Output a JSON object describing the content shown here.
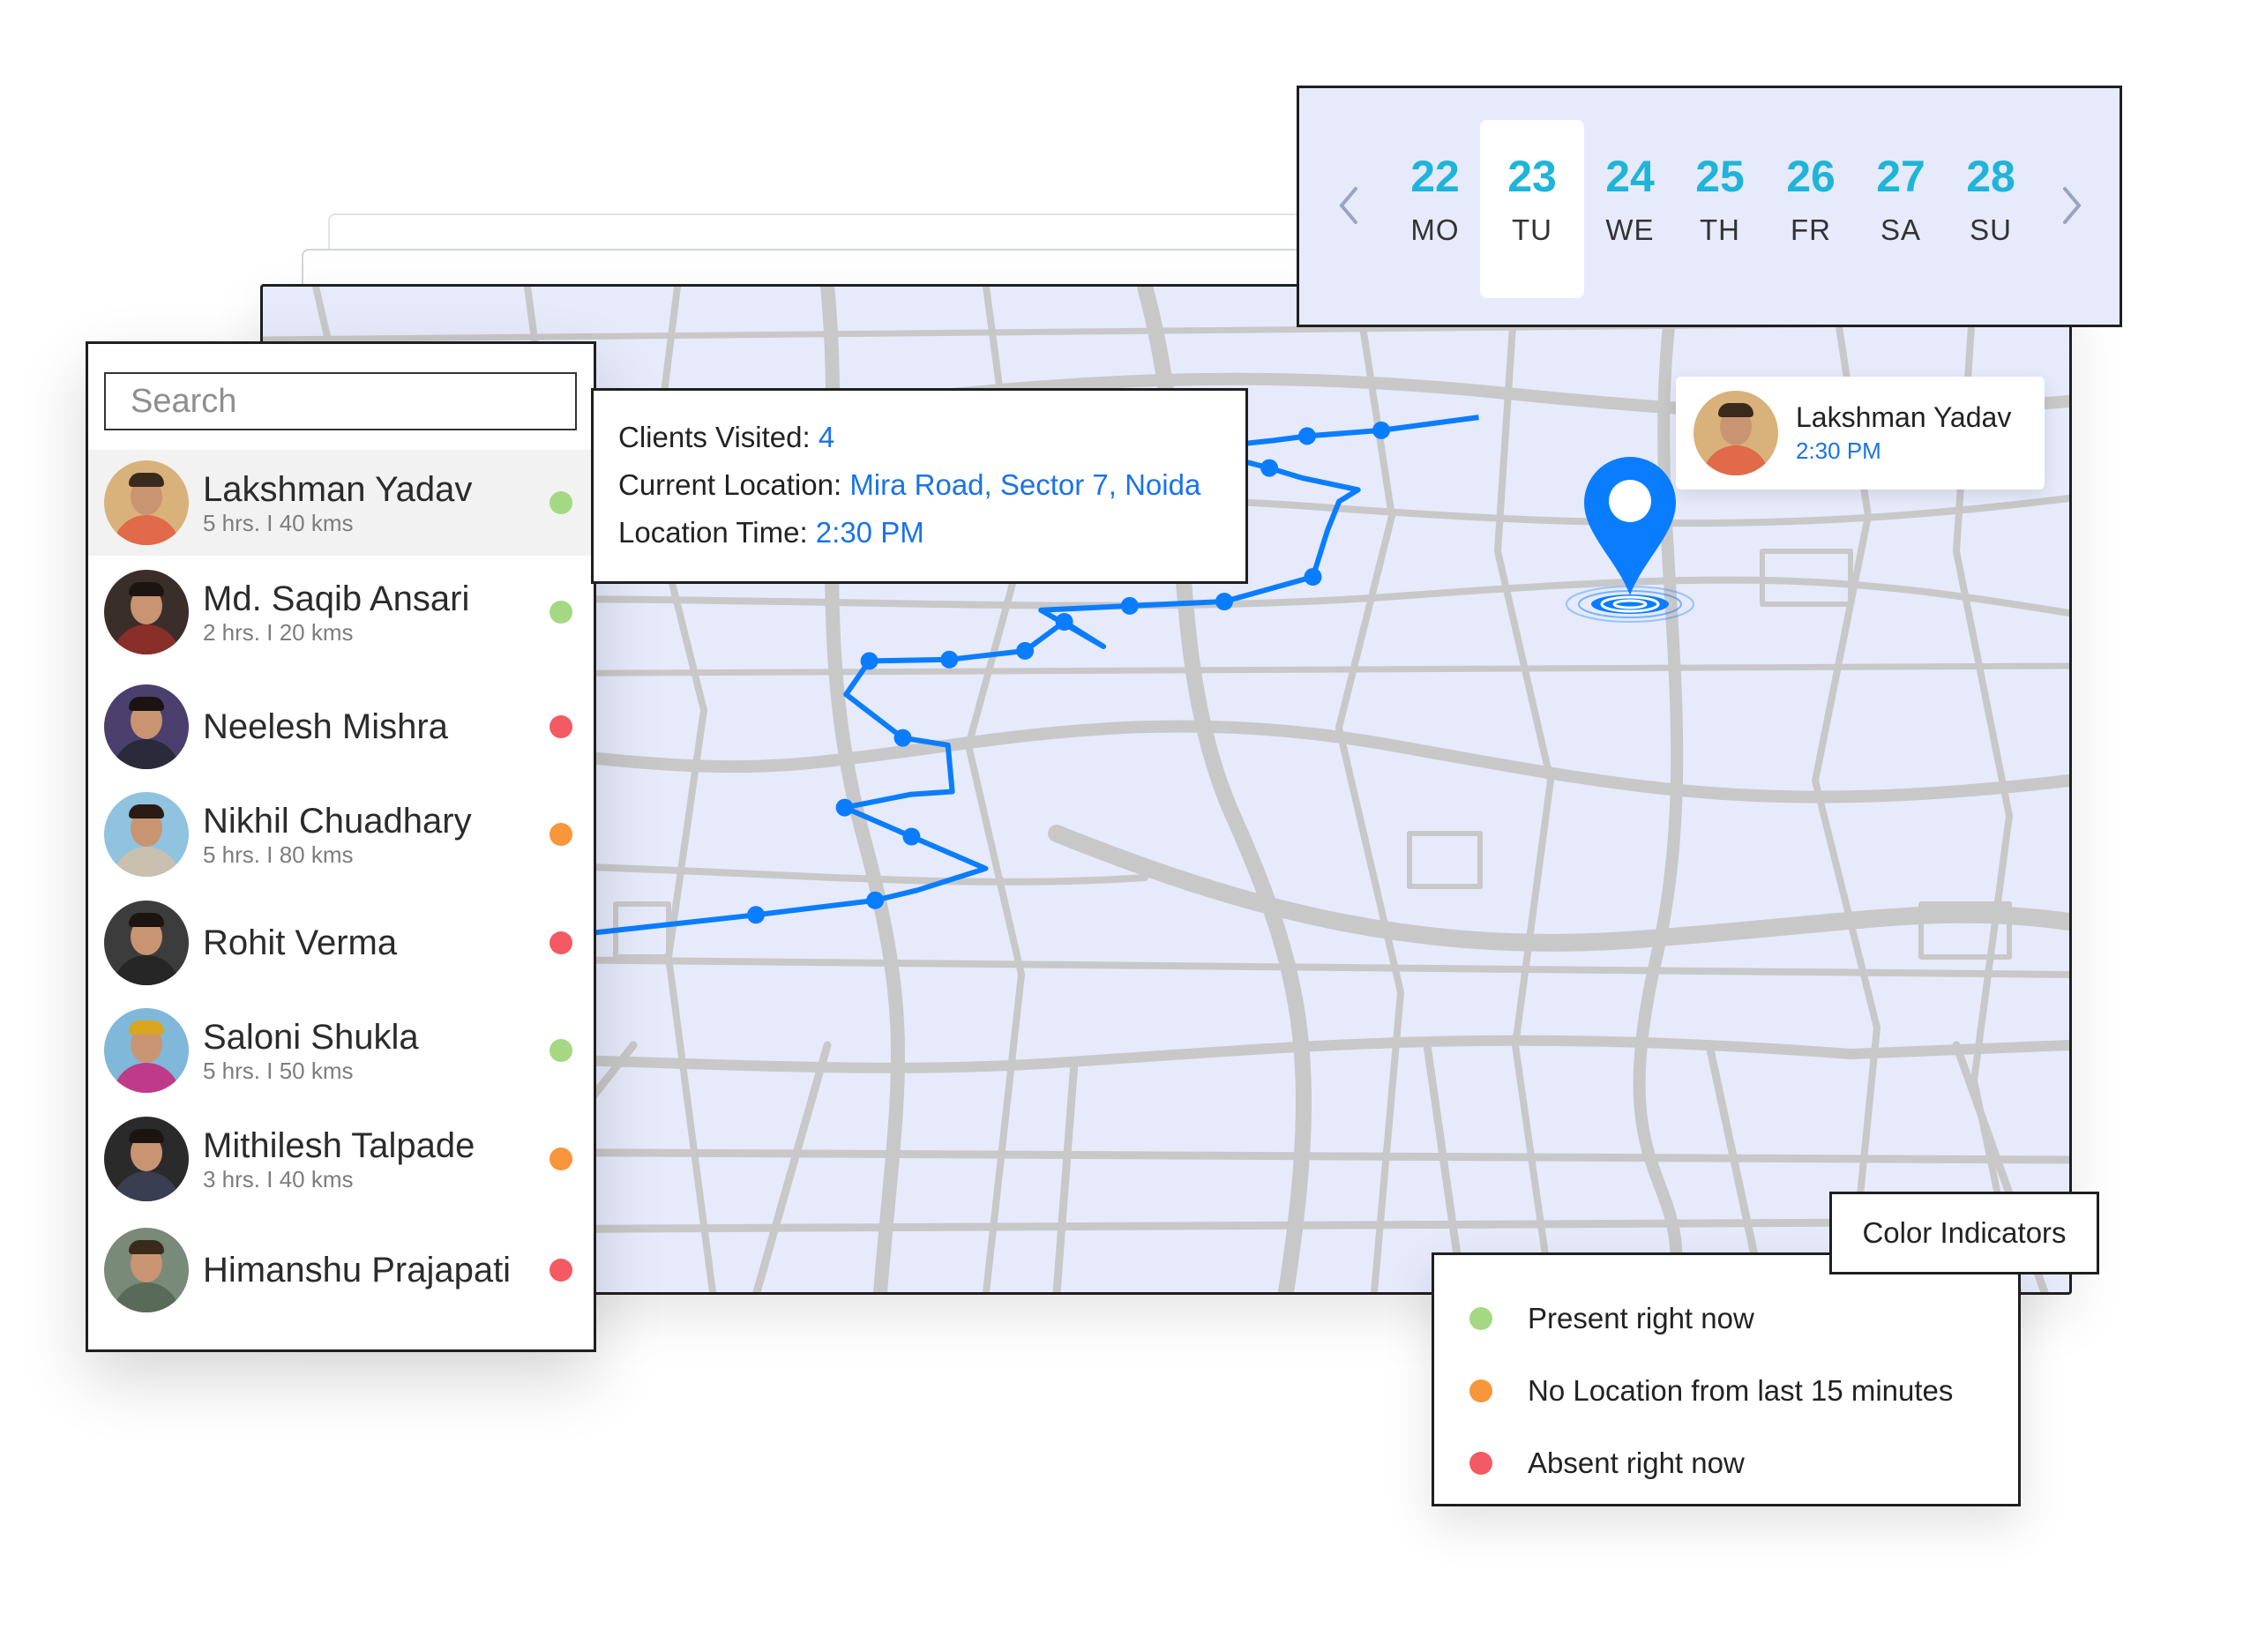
{
  "search": {
    "placeholder": "Search"
  },
  "colors": {
    "present": "#a5d883",
    "no_location": "#f7963a",
    "absent": "#f35a63",
    "accent_blue": "#0a7dff",
    "date_teal": "#1fb4da"
  },
  "employees": [
    {
      "name": "Lakshman Yadav",
      "meta": "5 hrs. I 40 kms",
      "status": "present",
      "selected": true
    },
    {
      "name": "Md. Saqib Ansari",
      "meta": "2 hrs. I 20 kms",
      "status": "present"
    },
    {
      "name": "Neelesh Mishra",
      "meta": "",
      "status": "absent"
    },
    {
      "name": "Nikhil Chuadhary",
      "meta": "5 hrs. I 80 kms",
      "status": "no_location"
    },
    {
      "name": "Rohit Verma",
      "meta": "",
      "status": "absent"
    },
    {
      "name": "Saloni Shukla",
      "meta": "5 hrs. I 50 kms",
      "status": "present"
    },
    {
      "name": "Mithilesh Talpade",
      "meta": "3 hrs. I 40 kms",
      "status": "no_location"
    },
    {
      "name": "Himanshu Prajapati",
      "meta": "",
      "status": "absent"
    }
  ],
  "calendar": {
    "selected_index": 1,
    "days": [
      {
        "num": "22",
        "wd": "MO"
      },
      {
        "num": "23",
        "wd": "TU"
      },
      {
        "num": "24",
        "wd": "WE"
      },
      {
        "num": "25",
        "wd": "TH"
      },
      {
        "num": "26",
        "wd": "FR"
      },
      {
        "num": "27",
        "wd": "SA"
      },
      {
        "num": "28",
        "wd": "SU"
      }
    ]
  },
  "info": {
    "clients_label": "Clients Visited:",
    "clients_value": "4",
    "location_label": "Current Location:",
    "location_value": "Mira Road, Sector 7, Noida",
    "time_label": "Location Time:",
    "time_value": "2:30 PM"
  },
  "user_card": {
    "name": "Lakshman Yadav",
    "time": "2:30 PM"
  },
  "legend": {
    "title": "Color Indicators",
    "items": [
      {
        "label": "Present right now",
        "status": "present"
      },
      {
        "label": "No Location from last 15 minutes",
        "status": "no_location"
      },
      {
        "label": "Absent right now",
        "status": "absent"
      }
    ]
  }
}
